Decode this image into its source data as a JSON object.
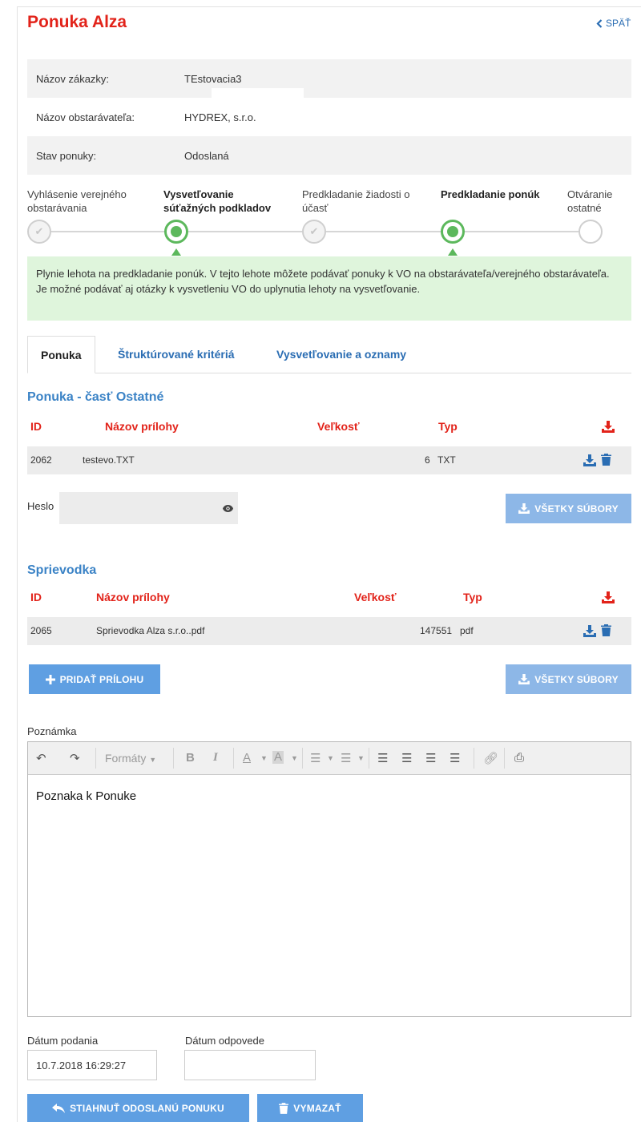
{
  "header": {
    "title": "Ponuka Alza",
    "back_label": "SPÄŤ"
  },
  "info": {
    "rows": [
      {
        "label": "Názov zákazky:",
        "value": "TEstovacia3"
      },
      {
        "label": "Názov obstarávateľa:",
        "value": "HYDREX, s.r.o."
      },
      {
        "label": "Stav ponuky:",
        "value": "Odoslaná"
      }
    ]
  },
  "steps": [
    {
      "line1": "Vyhlásenie verejného",
      "line2": "obstarávania",
      "state": "done"
    },
    {
      "line1": "Vysvetľovanie",
      "line2": "súťažných podkladov",
      "state": "active"
    },
    {
      "line1": "Predkladanie žiadosti o",
      "line2": "účasť",
      "state": "done"
    },
    {
      "line1": "Predkladanie ponúk",
      "line2": "",
      "state": "active"
    },
    {
      "line1": "Otváranie",
      "line2": "ostatné",
      "state": "pending"
    }
  ],
  "alert": {
    "text": "Plynie lehota na predkladanie ponúk. V tejto lehote môžete podávať ponuky k VO na obstarávateľa/verejného obstarávateľa. Je možné podávať aj otázky k vysvetleniu VO do uplynutia lehoty na vysvetľovanie."
  },
  "tabs": [
    "Ponuka",
    "Štruktúrované kritériá",
    "Vysvetľovanie a oznamy"
  ],
  "offer_section": {
    "title": "Ponuka - časť Ostatné",
    "headers": {
      "id": "ID",
      "name": "Názov prílohy",
      "size": "Veľkosť",
      "type": "Typ"
    },
    "rows": [
      {
        "id": "2062",
        "name": "testevo.TXT",
        "size": "6",
        "type": "TXT"
      }
    ],
    "password_label": "Heslo",
    "password_value": "",
    "all_files_label": "VŠETKY SÚBORY"
  },
  "cover_section": {
    "title": "Sprievodka",
    "headers": {
      "id": "ID",
      "name": "Názov prílohy",
      "size": "Veľkosť",
      "type": "Typ"
    },
    "rows": [
      {
        "id": "2065",
        "name": "Sprievodka Alza s.r.o..pdf",
        "size": "147551",
        "type": "pdf"
      }
    ],
    "add_attachment_label": "PRIDAŤ PRÍLOHU",
    "all_files_label": "VŠETKY SÚBORY"
  },
  "note": {
    "label": "Poznámka",
    "formats_label": "Formáty",
    "content": "Poznaka k Ponuke"
  },
  "dates": {
    "submitted_label": "Dátum podania",
    "submitted_value": "10.7.2018 16:29:27",
    "response_label": "Dátum odpovede",
    "response_value": ""
  },
  "actions": {
    "download_label": "STIAHNUŤ ODOSLANÚ PONUKU",
    "delete_label": "VYMAZAŤ"
  },
  "colors": {
    "brand_red": "#e2231a",
    "link_blue": "#2a6db3",
    "button_blue": "#8db7e7",
    "success_green": "#5cb85c",
    "alert_bg": "#dff5dc"
  }
}
